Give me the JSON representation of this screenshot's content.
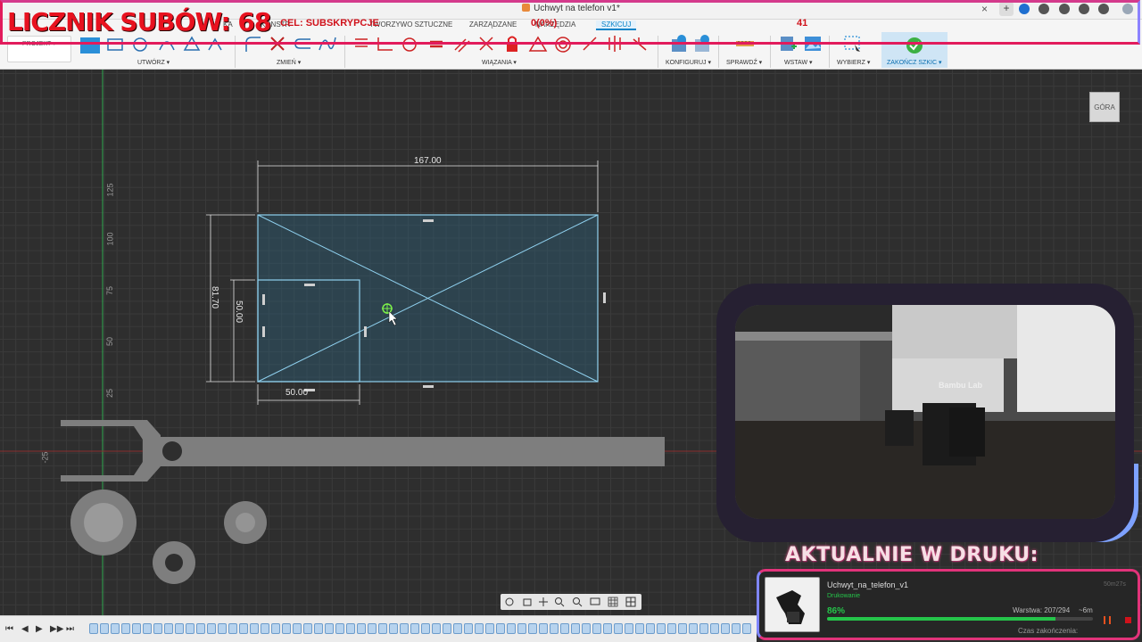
{
  "app": {
    "doc_title": "Uchwyt na telefon v1*",
    "close_glyph": "×",
    "new_tab_glyph": "+",
    "tabs": [
      "KONSTR",
      "KA",
      "TWORZYWO SZTUCZNE",
      "ZARZĄDZANE",
      "NARZĘDZIA",
      "SZKICUJ"
    ],
    "active_tab": "SZKICUJ",
    "project_button": "PROJEKT ▾"
  },
  "ribbon": {
    "groups": [
      "UTWÓRZ ▾",
      "ZMIEŃ ▾",
      "WIĄZANIA ▾",
      "KONFIGURUJ ▾",
      "SPRAWDŹ ▾",
      "WSTAW ▾",
      "WYBIERZ ▾",
      "ZAKOŃCZ SZKIC ▾"
    ],
    "accent": "#0a84c8"
  },
  "canvas": {
    "axis_labels": [
      "125",
      "100",
      "75",
      "50",
      "25",
      "-25"
    ],
    "dimensions": {
      "width_total": "167.00",
      "height_total": "81.70",
      "inner_height": "50.00",
      "inner_width": "50.00"
    },
    "viewcube_label": "GÓRA"
  },
  "overlay": {
    "sub_counter": "LICZNIK SUBÓW: 68",
    "goal_label": "CEL: SUBSKRYPCJE",
    "goal_count": "0(0%)",
    "goal_target": "41",
    "now_printing": "AKTUALNIE W DRUKU:",
    "camera_brand": "Bambu Lab"
  },
  "print_card": {
    "file_name": "Uchwyt_na_telefon_v1",
    "elapsed": "50m27s",
    "status": "Drukowanie",
    "percent": "86%",
    "progress": 0.86,
    "layer": "Warstwa: 207/294",
    "remaining": "~6m",
    "end_time_label": "Czas zakończenia:"
  },
  "timeline": {
    "buttons": [
      "⏮",
      "◀",
      "▶",
      "▶▶",
      "⏭"
    ]
  }
}
